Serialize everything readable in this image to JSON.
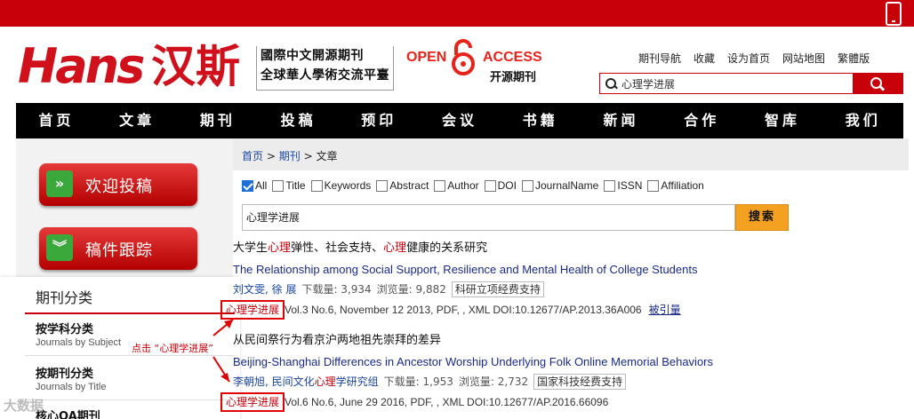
{
  "header": {
    "logo_en": "Hans",
    "logo_cn": "汉斯",
    "tagline_1": "國際中文開源期刊",
    "tagline_2": "全球華人學術交流平臺",
    "oa_open": "OPEN",
    "oa_access": "ACCESS",
    "oa_cn": "开源期刊",
    "links": [
      "期刊导航",
      "收藏",
      "设为首页",
      "网站地图",
      "繁體版"
    ],
    "search_value": "心理学进展"
  },
  "nav": [
    "首页",
    "文章",
    "期刊",
    "投稿",
    "预印",
    "会议",
    "书籍",
    "新闻",
    "合作",
    "智库",
    "我们"
  ],
  "sidebar": {
    "buttons": [
      "欢迎投稿",
      "稿件跟踪"
    ],
    "journal_class": {
      "title": "期刊分类",
      "items": [
        {
          "cn": "按学科分类",
          "en": "Journals by Subject"
        },
        {
          "cn": "按期刊分类",
          "en": "Journals by Title"
        },
        {
          "cn": "核心OA期刊",
          "en": ""
        }
      ]
    }
  },
  "breadcrumb": {
    "home": "首页",
    "journal": "期刊",
    "sep": ">",
    "current": "文章"
  },
  "search_fields": [
    {
      "label": "All",
      "checked": true
    },
    {
      "label": "Title",
      "checked": false
    },
    {
      "label": "Keywords",
      "checked": false
    },
    {
      "label": "Abstract",
      "checked": false
    },
    {
      "label": "Author",
      "checked": false
    },
    {
      "label": "DOI",
      "checked": false
    },
    {
      "label": "JournalName",
      "checked": false
    },
    {
      "label": "ISSN",
      "checked": false
    },
    {
      "label": "Affiliation",
      "checked": false
    }
  ],
  "main_search": {
    "value": "心理学进展",
    "button": "搜索"
  },
  "articles": [
    {
      "title_cn_parts": [
        "大学生",
        "心理",
        "弹性、社会支持、",
        "心理",
        "健康的关系研究"
      ],
      "title_en": "The Relationship among Social Support, Resilience and Mental Health of College Students",
      "authors": "刘文雯, 徐 展",
      "downloads": "下载量: 3,934",
      "views": "浏览量: 9,882",
      "fund": "科研立项经费支持",
      "journal": "心理学进展",
      "source": "Vol.3 No.6, November 12 2013, PDF, , XML DOI:10.12677/AP.2013.36A006",
      "cited": "被引量"
    },
    {
      "title_cn": "从民间祭行为看京沪两地祖先崇拜的差异",
      "title_en": "Beijing-Shanghai Differences in Ancestor Worship Underlying Folk Online Memorial Behaviors",
      "authors_parts": [
        "李朝旭, 民间文化",
        "心理",
        "学研究组"
      ],
      "downloads": "下载量: 1,953",
      "views": "浏览量: 2,732",
      "fund": "国家科技经费支持",
      "journal": "心理学进展",
      "source": "Vol.6 No.6, June 29 2016, PDF, , XML DOI:10.12677/AP.2016.66096"
    }
  ],
  "annotation": "点击 “心理学进展”",
  "watermark": "大数据",
  "colors": {
    "brand_red": "#c8000a",
    "nav_bg": "#000000",
    "search_btn": "#f4a020",
    "link_blue": "#1a46a0"
  }
}
